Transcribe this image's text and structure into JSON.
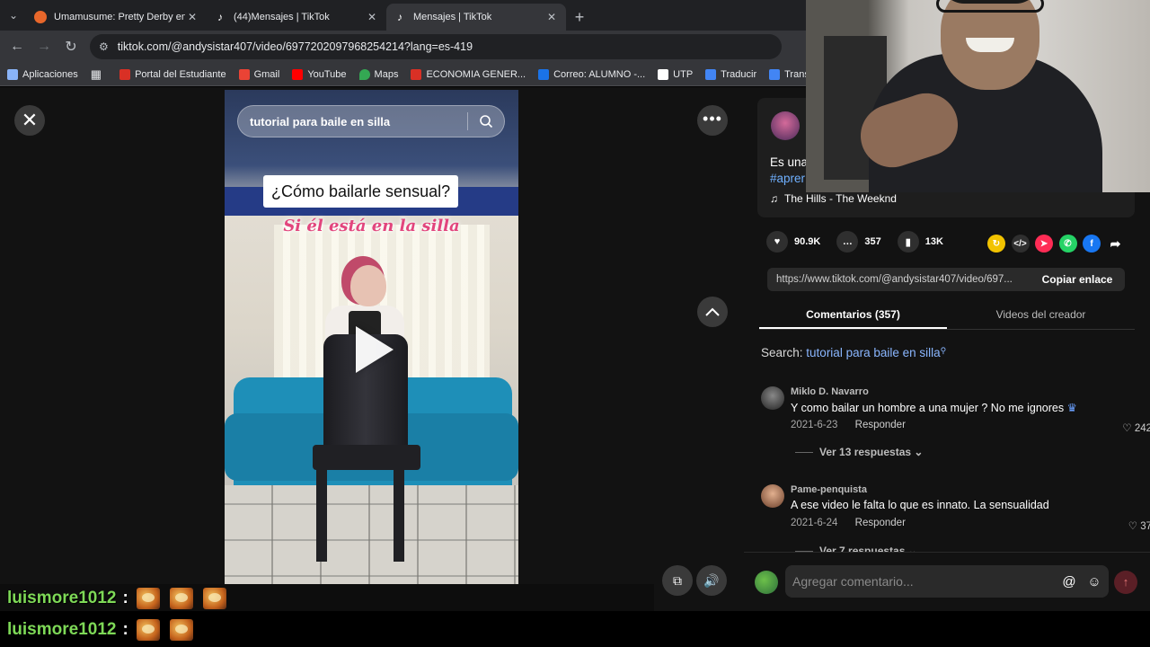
{
  "browser": {
    "tabs": [
      {
        "title": "Umamusume: Pretty Derby en I",
        "active": false,
        "favicon": "uma-icon"
      },
      {
        "title": "(44)Mensajes | TikTok",
        "active": false,
        "favicon": "tiktok-icon"
      },
      {
        "title": "Mensajes | TikTok",
        "active": true,
        "favicon": "tiktok-icon"
      }
    ],
    "url": "tiktok.com/@andysistar407/video/6977202097968254214?lang=es-419",
    "bookmarks": [
      {
        "label": "Aplicaciones",
        "color": "#8ab4f8"
      },
      {
        "label": "Portal del Estudiante",
        "color": "#d93025"
      },
      {
        "label": "Gmail",
        "color": "#ea4335"
      },
      {
        "label": "YouTube",
        "color": "#ff0000"
      },
      {
        "label": "Maps",
        "color": "#34a853"
      },
      {
        "label": "ECONOMIA GENER...",
        "color": "#d93025"
      },
      {
        "label": "Correo: ALUMNO -...",
        "color": "#1a73e8"
      },
      {
        "label": "UTP",
        "color": "#ffffff"
      },
      {
        "label": "Traducir",
        "color": "#4285f4"
      },
      {
        "label": "Translate",
        "color": "#4285f4"
      }
    ]
  },
  "video": {
    "search_placeholder": "tutorial para baile en silla",
    "caption_main": "¿Cómo bailarle sensual?",
    "caption_sub": "Si él está en la silla"
  },
  "panel": {
    "description_start": "Es una",
    "hashtag_start": "#aprer",
    "music": "The Hills - The Weeknd",
    "likes": "90.9K",
    "comments": "357",
    "saves": "13K",
    "share_link": "https://www.tiktok.com/@andysistar407/video/697...",
    "copy_label": "Copiar enlace",
    "tabs": [
      "Comentarios (357)",
      "Videos del creador"
    ],
    "search_label": "Search:",
    "search_term": "tutorial para baile en silla",
    "comments_list": [
      {
        "user": "Miklo D. Navarro",
        "text": "Y como bailar un hombre a una mujer ? No me ignores",
        "date": "2021-6-23",
        "reply": "Responder",
        "likes": "242",
        "more": "Ver 13 respuestas"
      },
      {
        "user": "Pame-penquista",
        "text": "A ese video le falta lo que es innato. La sensualidad",
        "date": "2021-6-24",
        "reply": "Responder",
        "likes": "37",
        "more": "Ver 7 respuestas"
      }
    ],
    "comment_placeholder": "Agregar comentario..."
  },
  "chat": [
    {
      "user": "luismore1012",
      "emotes": 3
    },
    {
      "user": "luismore1012",
      "emotes": 2
    }
  ],
  "colors": {
    "accent_link": "#6fb0ff",
    "chat_name": "#7ed957",
    "send_button": "#5a1f26"
  }
}
